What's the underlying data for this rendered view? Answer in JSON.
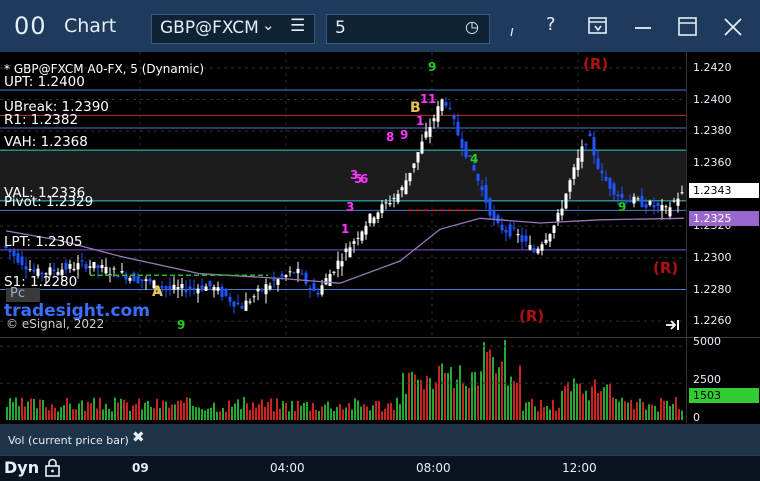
{
  "window": {
    "app_icon": "00",
    "title": "Chart",
    "symbol": "GBP@FXCM",
    "interval": "5",
    "icons": [
      "chevron-down-icon",
      "list-menu-icon",
      "clock-icon",
      "draw-tool-icon",
      "help-icon",
      "template-icon",
      "minimize-icon",
      "maximize-icon",
      "close-icon"
    ]
  },
  "chart": {
    "title": "* GBP@FXCM A0-FX, 5 (Dynamic)",
    "copyright": "© eSignal, 2022",
    "watermark": "tradesight.com",
    "pc_label": "Pc",
    "markers": {
      "a": "A",
      "b": "B",
      "r": "(R)"
    },
    "seq_labels": [
      "9",
      "8",
      "9",
      "1",
      "3",
      "5",
      "6",
      "3",
      "1",
      "9",
      "1",
      "1",
      "9",
      "4"
    ],
    "levels": [
      {
        "label": "UPT: 1.2400",
        "value": 1.2406,
        "color": "#4a7bd0"
      },
      {
        "label": "UBreak: 1.2390",
        "value": 1.239,
        "color": "#c03030"
      },
      {
        "label": "R1: 1.2382",
        "value": 1.2382,
        "color": "#4a7bd0"
      },
      {
        "label": "VAH: 1.2368",
        "value": 1.2368,
        "color": "#33cccc"
      },
      {
        "label": "VAL: 1.2336",
        "value": 1.2336,
        "color": "#33cccc"
      },
      {
        "label": "Pivot: 1.2329",
        "value": 1.233,
        "color": "#4a7bd0"
      },
      {
        "label": "LPT: 1.2305",
        "value": 1.2305,
        "color": "#8855cc"
      },
      {
        "label": "S1: 1.2280",
        "value": 1.228,
        "color": "#4a7bd0"
      }
    ],
    "price_axis": {
      "min": 1.225,
      "max": 1.243,
      "ticks": [
        "1.2420",
        "1.2400",
        "1.2380",
        "1.2360",
        "1.2340",
        "1.2320",
        "1.2300",
        "1.2280",
        "1.2260"
      ],
      "last_price": "1.2343",
      "ma_price": "1.2325",
      "last_price_color": "#ffffff",
      "ma_price_color": "#9966cc"
    },
    "time_axis": {
      "ticks": [
        "09",
        "04:00",
        "08:00",
        "12:00"
      ]
    },
    "bar_colors": {
      "up": "#ffffff",
      "down": "#2255ff",
      "ma": "#9977bb"
    }
  },
  "volume": {
    "label": "Vol (current price bar)",
    "ticks": [
      "5000",
      "2500",
      "0"
    ],
    "current": "1503",
    "current_color": "#33cc33",
    "max": 5000
  },
  "status": {
    "mode": "Dyn"
  }
}
